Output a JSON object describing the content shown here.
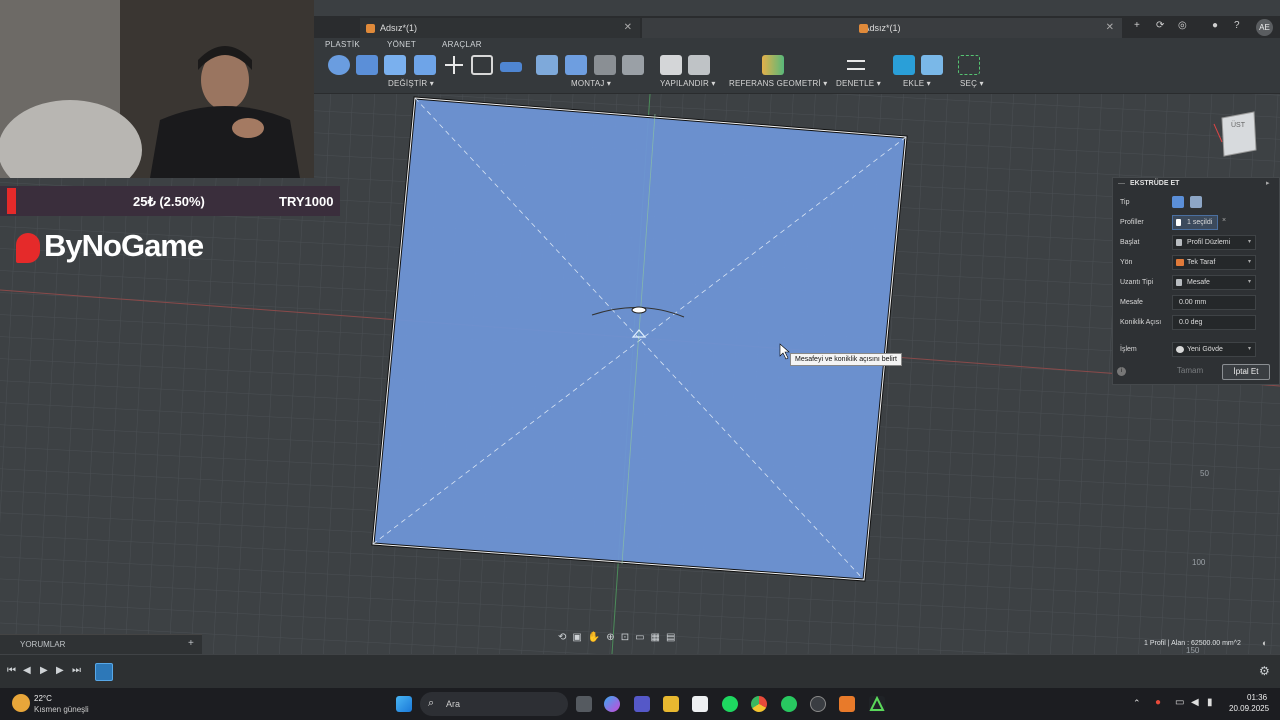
{
  "tabs": [
    {
      "label": "Adsız*(1)"
    },
    {
      "label": "Adsız*(1)"
    }
  ],
  "user_initials": "AE",
  "menu_tabs": [
    "PLASTİK",
    "YÖNET",
    "ARAÇLAR"
  ],
  "toolbar_groups": {
    "degistir": "DEĞİŞTİR ▾",
    "montaj": "MONTAJ ▾",
    "yapilandir": "YAPILANDIR ▾",
    "referans": "REFERANS GEOMETRİ ▾",
    "denetle": "DENETLE ▾",
    "ekle": "EKLE ▾",
    "sec": "SEÇ ▾"
  },
  "overlay": {
    "donation_amount": "25₺ (2.50%)",
    "donation_goal": "TRY1000",
    "brand": "ByNoGame"
  },
  "viewcube_label": "ÜST",
  "canvas_tooltip": "Mesafeyi ve koniklik açısını belirt",
  "axis_ticks": [
    "50",
    "100",
    "150"
  ],
  "panel": {
    "title": "EKSTRÜDE ET",
    "rows": [
      {
        "label": "Tip",
        "value": ""
      },
      {
        "label": "Profiller",
        "value": "1 seçildi"
      },
      {
        "label": "Başlat",
        "value": "Profil Düzlemi"
      },
      {
        "label": "Yön",
        "value": "Tek Taraf"
      },
      {
        "label": "Uzantı Tipi",
        "value": "Mesafe"
      },
      {
        "label": "Mesafe",
        "value": "0.00 mm"
      },
      {
        "label": "Koniklik Açısı",
        "value": "0.0 deg"
      },
      {
        "label": "İşlem",
        "value": "Yeni Gövde"
      }
    ],
    "ok": "Tamam",
    "cancel": "İptal Et"
  },
  "status": "1 Profil | Alan : 62500.00 mm^2",
  "comments_label": "YORUMLAR",
  "comments_add": "+",
  "weather": {
    "temp": "22°C",
    "desc": "Kısmen güneşli"
  },
  "search_placeholder": "Ara",
  "clock": {
    "time": "01:36",
    "date": "20.09.2025"
  },
  "colors": {
    "sketch_fill": "#6e95d6",
    "donation_bar": "#e52a2a",
    "primary_button": "#3a3e42"
  }
}
